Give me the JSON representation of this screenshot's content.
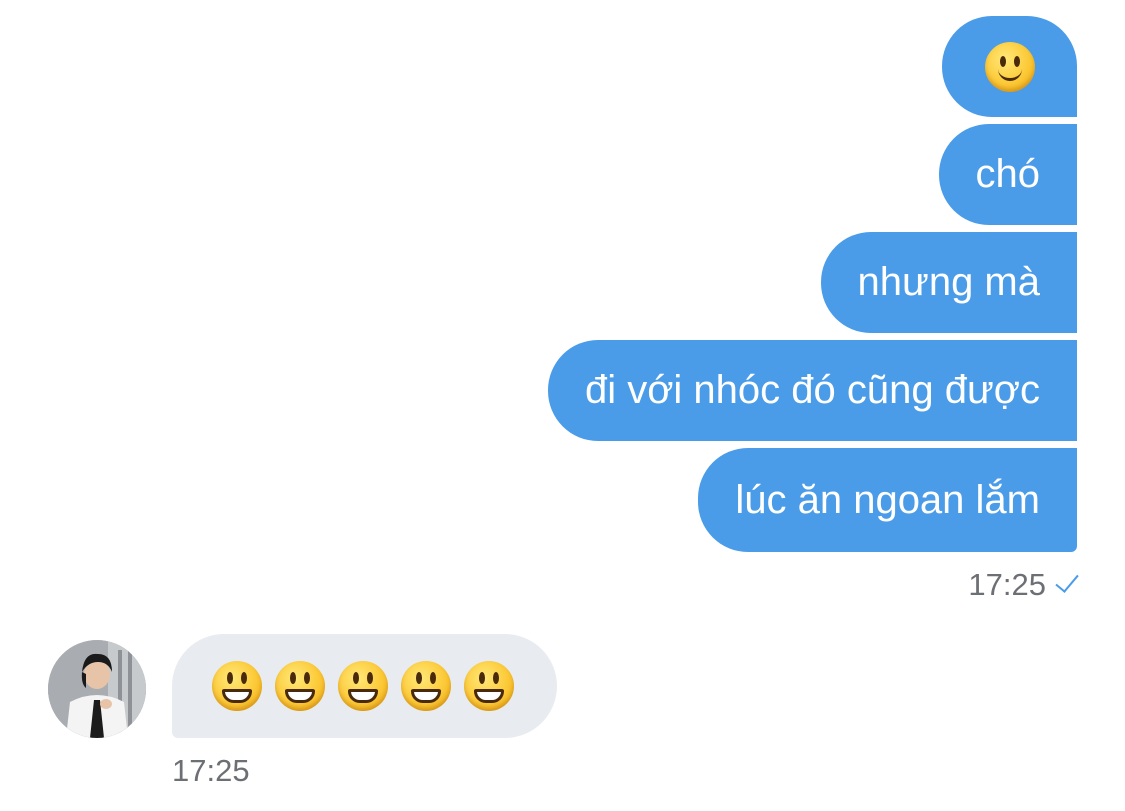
{
  "outgoing": {
    "messages": [
      {
        "text": "",
        "emoji": "slightly-smiling-face-emoji"
      },
      {
        "text": "chó"
      },
      {
        "text": "nhưng mà"
      },
      {
        "text": "đi với nhóc đó cũng được"
      },
      {
        "text": "lúc ăn ngoan lắm"
      }
    ],
    "time": "17:25",
    "status_icon": "single-check-icon"
  },
  "incoming": {
    "emoji": "grinning-face-emoji",
    "emoji_count": 5,
    "time": "17:25"
  },
  "colors": {
    "outgoing_bubble": "#4a9ce9",
    "incoming_bubble": "#e8ebf0",
    "timestamp": "#6c6f74",
    "check": "#4a9ce9"
  }
}
